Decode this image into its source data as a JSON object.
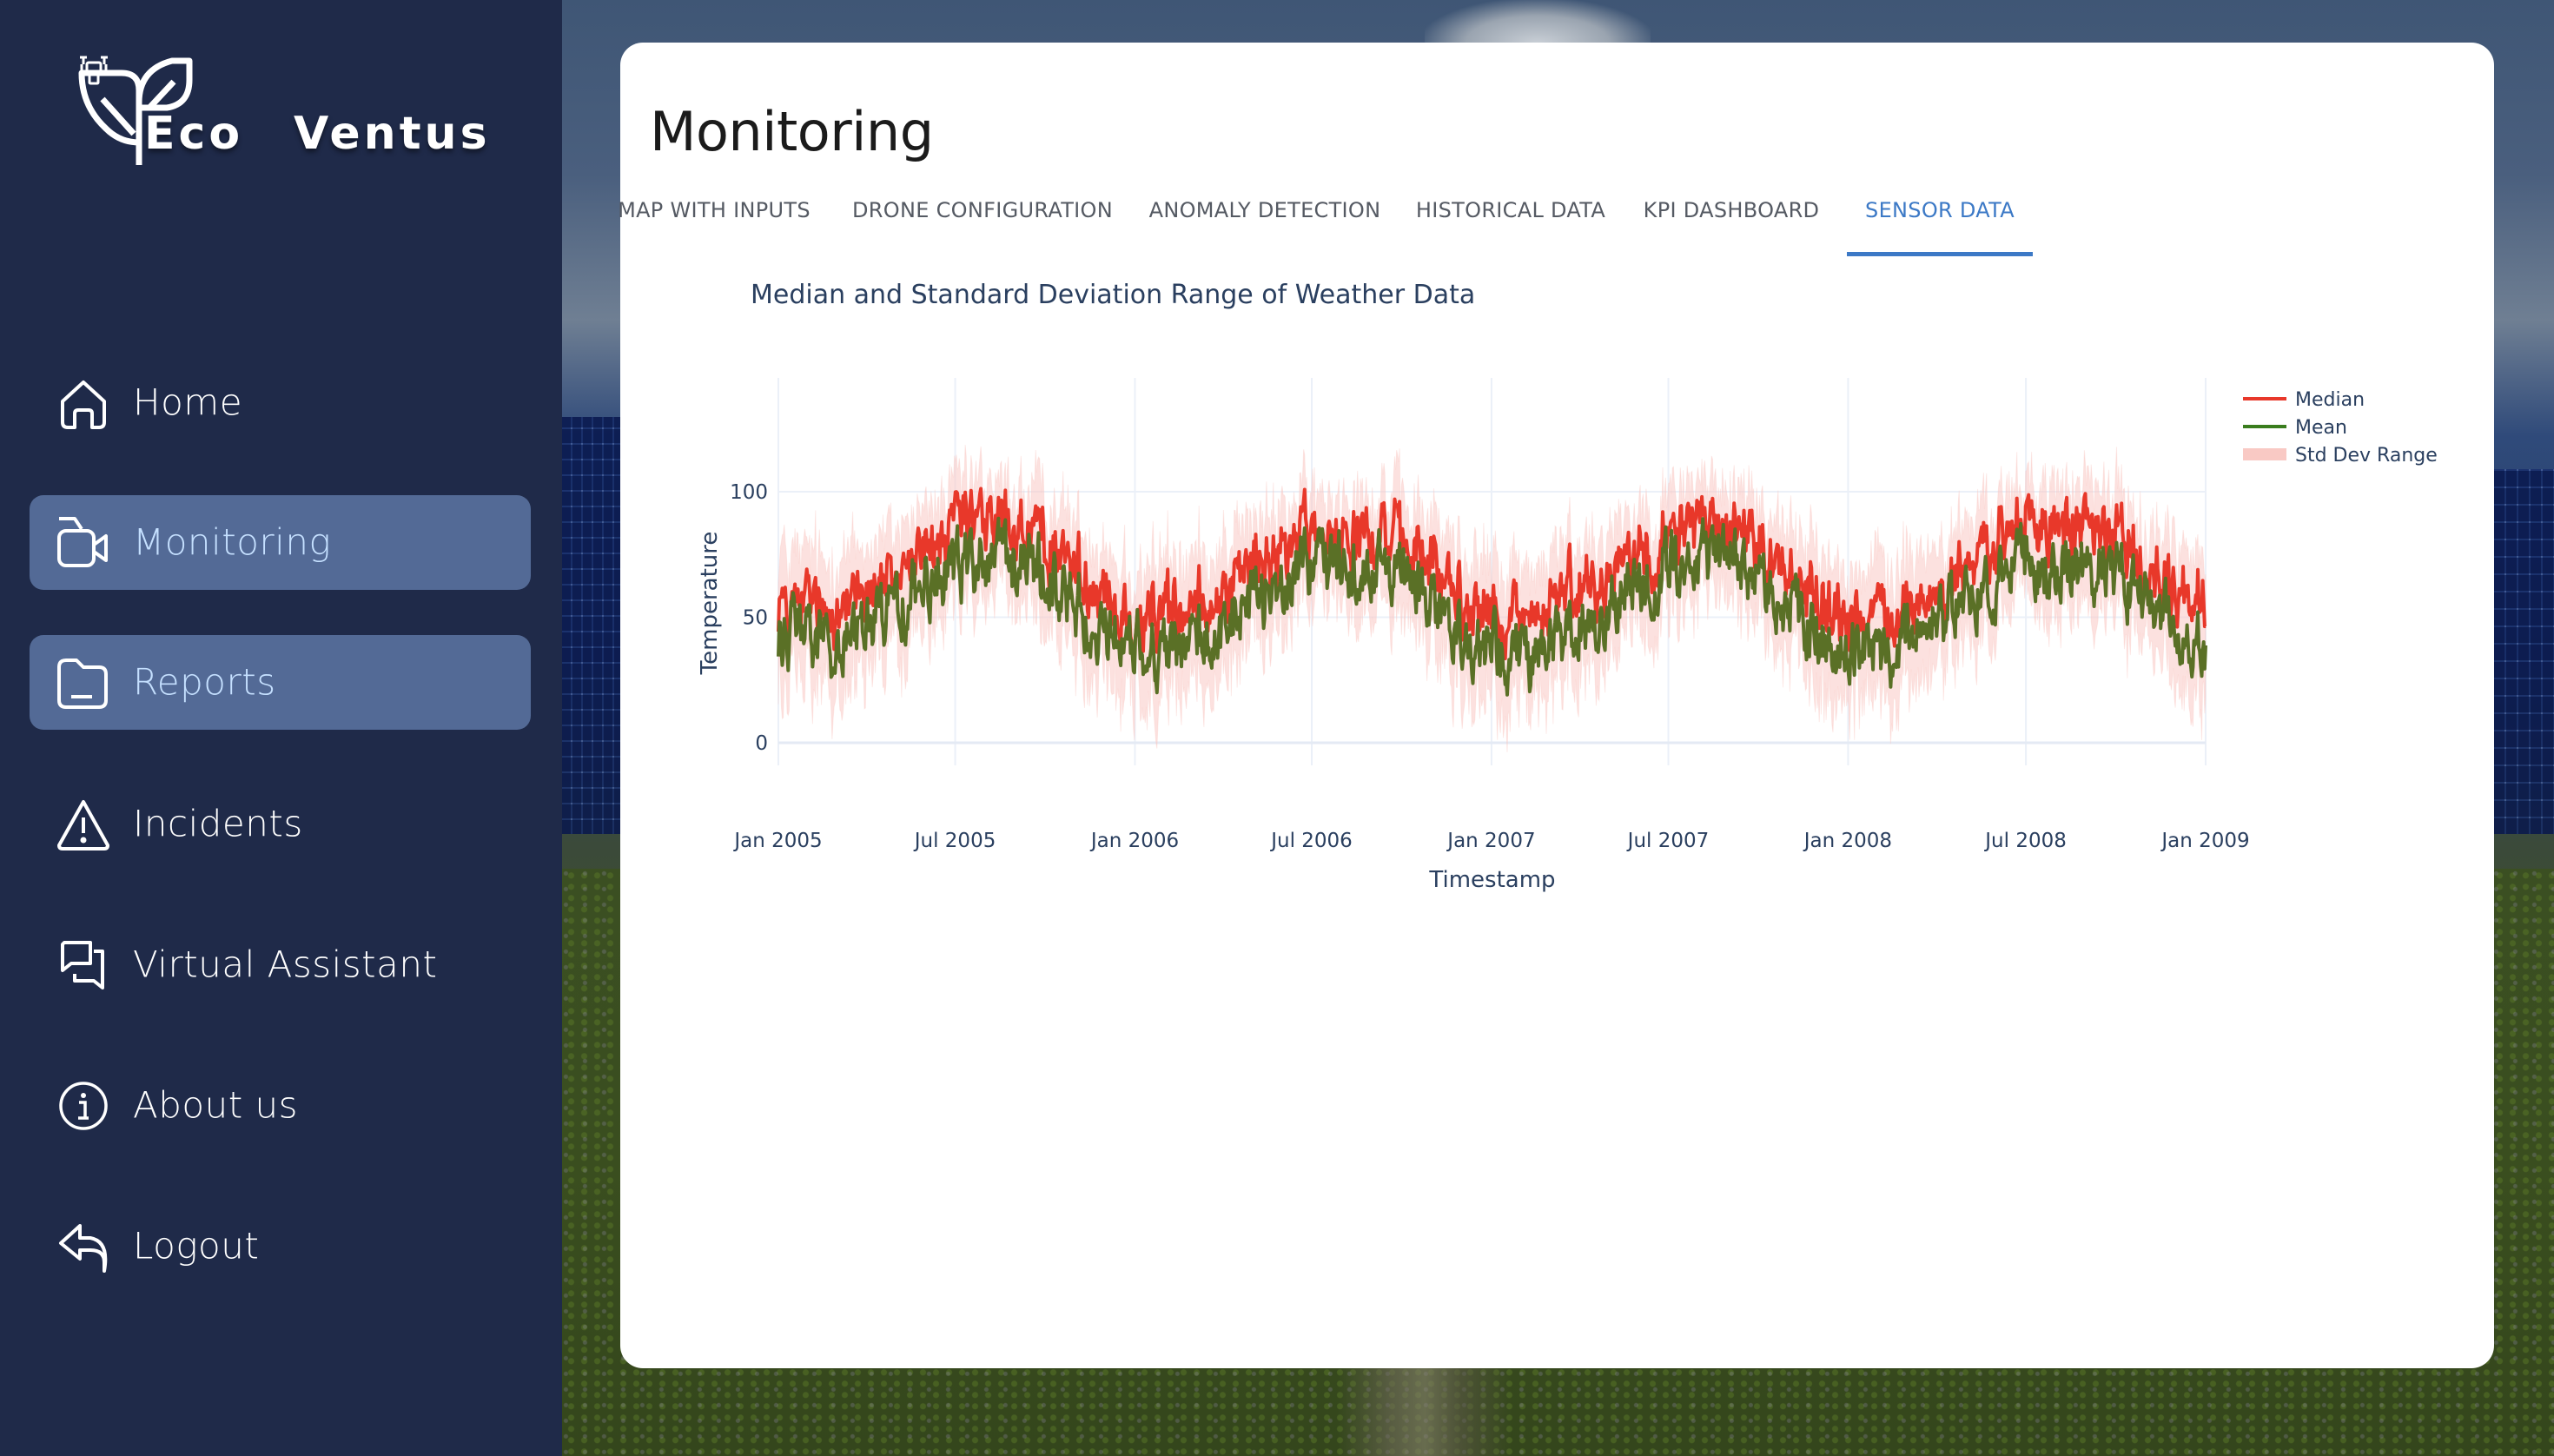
{
  "brand": {
    "name_left": "Eco",
    "name_right": "Ventus"
  },
  "sidebar": {
    "items": [
      {
        "label": "Home",
        "icon": "home-icon",
        "active": false
      },
      {
        "label": "Monitoring",
        "icon": "video-camera-icon",
        "active": true
      },
      {
        "label": "Reports",
        "icon": "folder-icon",
        "active": true
      },
      {
        "label": "Incidents",
        "icon": "warning-triangle-icon",
        "active": false
      },
      {
        "label": "Virtual Assistant",
        "icon": "chat-bubbles-icon",
        "active": false
      },
      {
        "label": "About us",
        "icon": "info-circle-icon",
        "active": false
      },
      {
        "label": "Logout",
        "icon": "logout-arrow-icon",
        "active": false
      }
    ]
  },
  "page": {
    "title": "Monitoring",
    "tabs": [
      {
        "label": "MAP WITH INPUTS",
        "active": false
      },
      {
        "label": "DRONE CONFIGURATION",
        "active": false
      },
      {
        "label": "ANOMALY DETECTION",
        "active": false
      },
      {
        "label": "HISTORICAL DATA",
        "active": false
      },
      {
        "label": "KPI DASHBOARD",
        "active": false
      },
      {
        "label": "SENSOR DATA",
        "active": true
      }
    ]
  },
  "colors": {
    "sidebar_bg": "#1f2a49",
    "sidebar_active_bg": "#536a96",
    "sidebar_active_text": "#c5e0ff",
    "tab_active": "#3c79c6",
    "median": "#e8382a",
    "mean": "#5a7026",
    "mean_legend": "#3a7d1e",
    "std_band": "#f9c9c4"
  },
  "chart_data": {
    "type": "line",
    "title": "Median and Standard Deviation Range of Weather Data",
    "xlabel": "Timestamp",
    "ylabel": "Temperature",
    "x_range": [
      "2005-01-01",
      "2009-01-01"
    ],
    "ylim": [
      -25,
      145
    ],
    "y_ticks": [
      0,
      50,
      100
    ],
    "x_ticks": [
      "Jan 2005",
      "Jul 2005",
      "Jan 2006",
      "Jul 2006",
      "Jan 2007",
      "Jul 2007",
      "Jan 2008",
      "Jul 2008",
      "Jan 2009"
    ],
    "grid": true,
    "legend_position": "top-right",
    "legend": [
      "Median",
      "Mean",
      "Std Dev Range"
    ],
    "resolution": "monthly estimate (daily noisy series in source)",
    "months": [
      "2005-01",
      "2005-02",
      "2005-03",
      "2005-04",
      "2005-05",
      "2005-06",
      "2005-07",
      "2005-08",
      "2005-09",
      "2005-10",
      "2005-11",
      "2005-12",
      "2006-01",
      "2006-02",
      "2006-03",
      "2006-04",
      "2006-05",
      "2006-06",
      "2006-07",
      "2006-08",
      "2006-09",
      "2006-10",
      "2006-11",
      "2006-12",
      "2007-01",
      "2007-02",
      "2007-03",
      "2007-04",
      "2007-05",
      "2007-06",
      "2007-07",
      "2007-08",
      "2007-09",
      "2007-10",
      "2007-11",
      "2007-12",
      "2008-01",
      "2008-02",
      "2008-03",
      "2008-04",
      "2008-05",
      "2008-06",
      "2008-07",
      "2008-08",
      "2008-09",
      "2008-10",
      "2008-11",
      "2008-12"
    ],
    "series": [
      {
        "name": "Median",
        "values": [
          58,
          52,
          58,
          64,
          72,
          80,
          86,
          87,
          84,
          76,
          64,
          54,
          50,
          52,
          58,
          66,
          74,
          80,
          84,
          85,
          82,
          74,
          64,
          54,
          50,
          48,
          58,
          66,
          76,
          82,
          87,
          88,
          84,
          74,
          62,
          52,
          48,
          50,
          58,
          66,
          76,
          82,
          86,
          86,
          84,
          76,
          64,
          56
        ]
      },
      {
        "name": "Mean",
        "values": [
          45,
          38,
          44,
          52,
          60,
          68,
          72,
          73,
          70,
          62,
          50,
          40,
          36,
          38,
          44,
          52,
          60,
          68,
          72,
          72,
          68,
          60,
          50,
          40,
          36,
          34,
          44,
          54,
          62,
          70,
          74,
          74,
          70,
          60,
          48,
          38,
          34,
          36,
          44,
          54,
          62,
          70,
          72,
          72,
          70,
          62,
          50,
          40
        ]
      },
      {
        "name": "Std Dev",
        "values": [
          16,
          17,
          16,
          15,
          14,
          13,
          13,
          13,
          14,
          15,
          16,
          17,
          17,
          17,
          16,
          15,
          14,
          13,
          13,
          13,
          14,
          15,
          16,
          17,
          17,
          17,
          16,
          15,
          14,
          13,
          13,
          13,
          14,
          15,
          16,
          17,
          17,
          17,
          16,
          15,
          14,
          13,
          13,
          13,
          14,
          15,
          16,
          17
        ]
      }
    ]
  }
}
